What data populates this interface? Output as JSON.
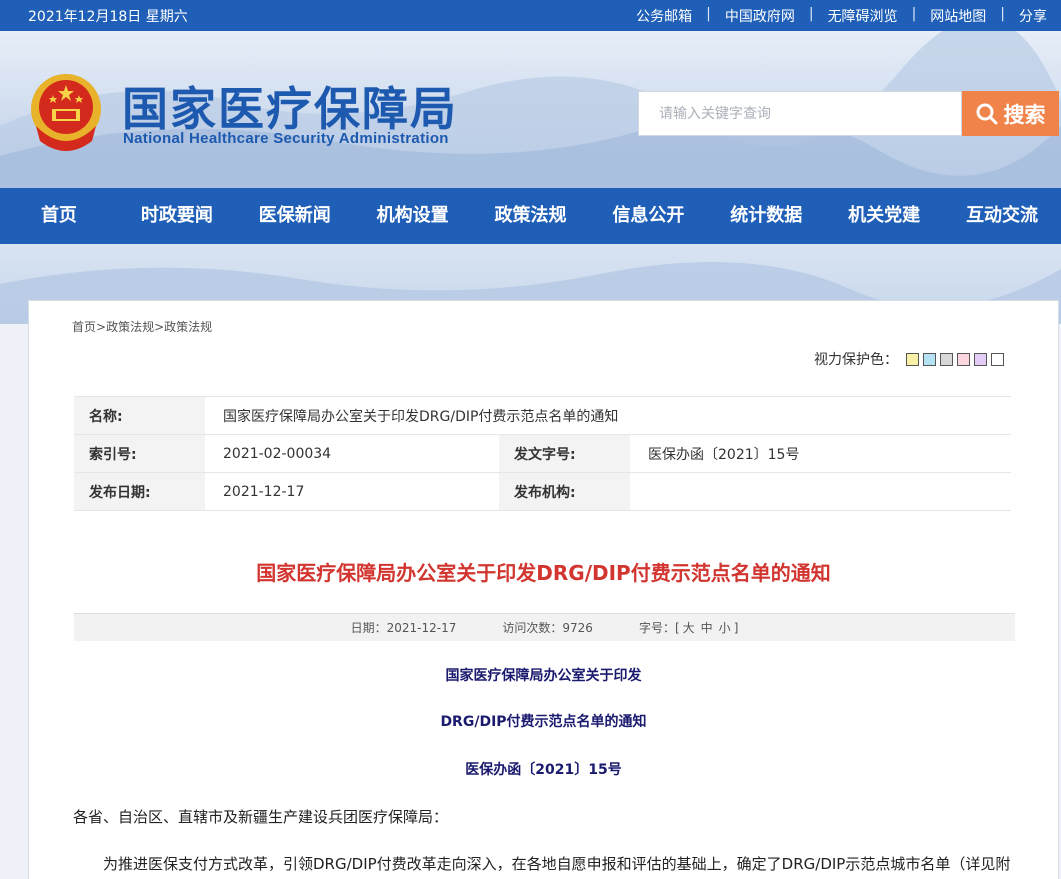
{
  "topbar": {
    "date": "2021年12月18日 星期六",
    "links": [
      "公务邮箱",
      "中国政府网",
      "无障碍浏览",
      "网站地图",
      "分享"
    ]
  },
  "header": {
    "title_cn": "国家医疗保障局",
    "title_en": "National Healthcare Security Administration"
  },
  "search": {
    "placeholder": "请输入关键字查询",
    "button_label": "搜索"
  },
  "nav": [
    "首页",
    "时政要闻",
    "医保新闻",
    "机构设置",
    "政策法规",
    "信息公开",
    "统计数据",
    "机关党建",
    "互动交流"
  ],
  "breadcrumb": [
    "首页",
    "政策法规",
    "政策法规"
  ],
  "eye_protection": {
    "label": "视力保护色：",
    "colors": [
      "#faf1a8",
      "#b5e2f2",
      "#d8d8d8",
      "#fbd6df",
      "#e3cdf6",
      "#ffffff"
    ]
  },
  "meta": {
    "name_label": "名称:",
    "name_value": "国家医疗保障局办公室关于印发DRG/DIP付费示范点名单的通知",
    "index_label": "索引号:",
    "index_value": "2021-02-00034",
    "docno_label": "发文字号:",
    "docno_value": "医保办函〔2021〕15号",
    "date_label": "发布日期:",
    "date_value": "2021-12-17",
    "org_label": "发布机构:",
    "org_value": ""
  },
  "article": {
    "headline": "国家医疗保障局办公室关于印发DRG/DIP付费示范点名单的通知",
    "info": {
      "date_label": "日期：",
      "date": "2021-12-17",
      "visits_label": "访问次数：",
      "visits": "9726",
      "font_label": "字号：",
      "font_open": "[",
      "font_large": "大",
      "font_medium": "中",
      "font_small": "小",
      "font_close": "]"
    },
    "doc_title_1": "国家医疗保障局办公室关于印发",
    "doc_title_2": "DRG/DIP付费示范点名单的通知",
    "doc_number": "医保办函〔2021〕15号",
    "salutation": "各省、自治区、直辖市及新疆生产建设兵团医疗保障局：",
    "body_1": "为推进医保支付方式改革，引领DRG/DIP付费改革走向深入，在各地自愿申报和评估的基础上，确定了DRG/DIP示范点城市名单（详见附"
  }
}
